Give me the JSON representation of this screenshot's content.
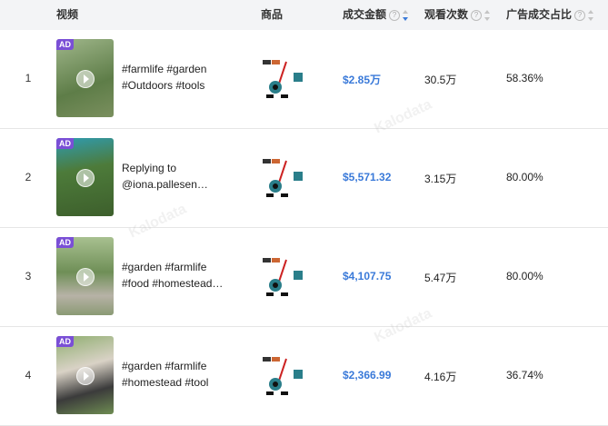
{
  "columns": {
    "video": "视频",
    "product": "商品",
    "sales": "成交金额",
    "views": "观看次数",
    "ad_ratio": "广告成交占比"
  },
  "ad_badge": "AD",
  "watermark": "Kalodata",
  "rows": [
    {
      "index": "1",
      "title_line1": "#farmlife #garden",
      "title_line2": "#Outdoors #tools",
      "sales": "$2.85万",
      "views": "30.5万",
      "ad_ratio": "58.36%",
      "thumb_color": "#7a9a66"
    },
    {
      "index": "2",
      "title_line1": "Replying to",
      "title_line2": "@iona.pallesen…",
      "sales": "$5,571.32",
      "views": "3.15万",
      "ad_ratio": "80.00%",
      "thumb_color": "#4f7a3f"
    },
    {
      "index": "3",
      "title_line1": "#garden #farmlife",
      "title_line2": "#food #homestead…",
      "sales": "$4,107.75",
      "views": "5.47万",
      "ad_ratio": "80.00%",
      "thumb_color": "#8ea880"
    },
    {
      "index": "4",
      "title_line1": "#garden #farmlife",
      "title_line2": "#homestead #tool",
      "sales": "$2,366.99",
      "views": "4.16万",
      "ad_ratio": "36.74%",
      "thumb_color": "#6e8c52"
    }
  ],
  "colors": {
    "accent": "#3a7ad9",
    "header_bg": "#f3f4f6",
    "ad_badge": "#7a4fd6"
  },
  "icons": {
    "help": "question-circle-icon",
    "sort": "sort-icon",
    "play": "play-icon"
  }
}
